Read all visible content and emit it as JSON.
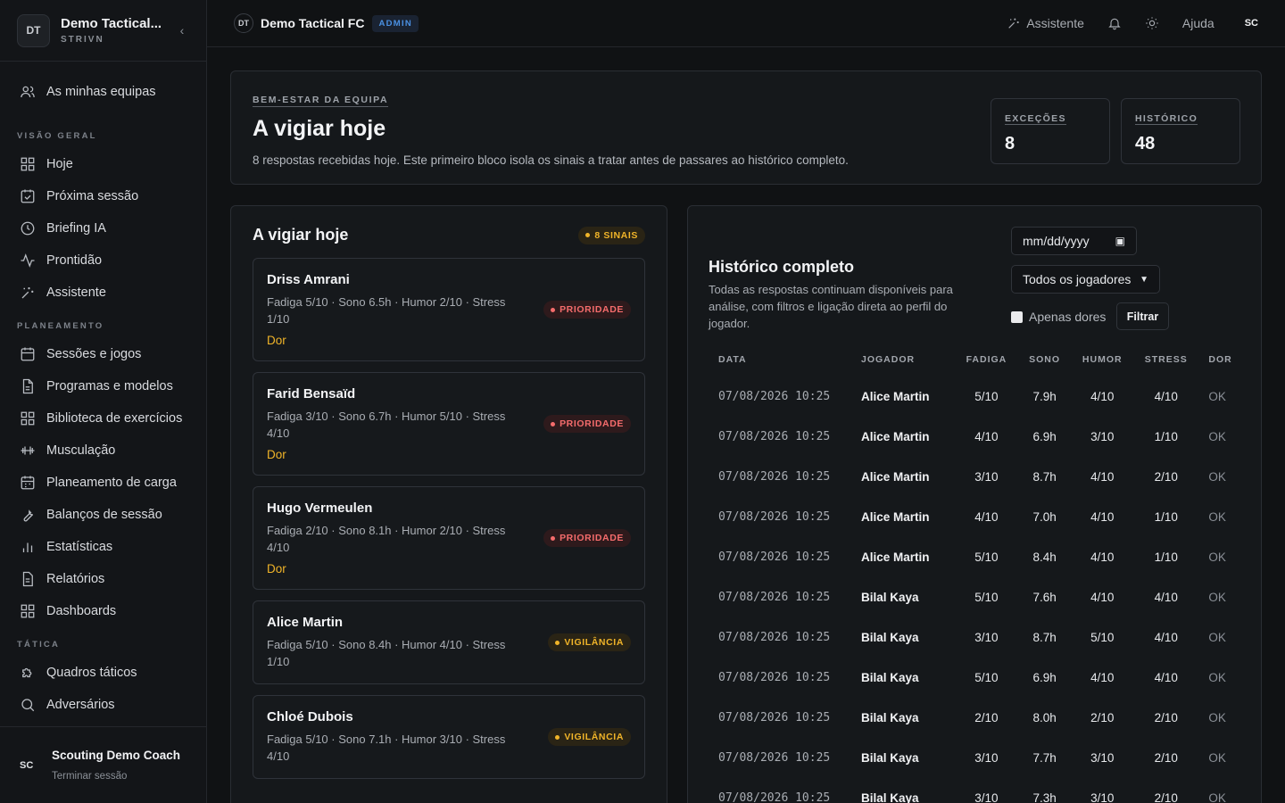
{
  "sidebar": {
    "team_initials": "DT",
    "team_name": "Demo Tactical...",
    "org": "STRIVN",
    "top_item": "As minhas equipas",
    "sections": [
      {
        "title": "VISÃO GERAL",
        "items": [
          "Hoje",
          "Próxima sessão",
          "Briefing IA",
          "Prontidão",
          "Assistente"
        ]
      },
      {
        "title": "PLANEAMENTO",
        "items": [
          "Sessões e jogos",
          "Programas e modelos",
          "Biblioteca de exercícios",
          "Musculação",
          "Planeamento de carga",
          "Balanços de sessão",
          "Estatísticas",
          "Relatórios",
          "Dashboards"
        ]
      },
      {
        "title": "TÁTICA",
        "items": [
          "Quadros táticos",
          "Adversários"
        ]
      }
    ],
    "user_initials": "SC",
    "user_name": "Scouting Demo Coach",
    "logout": "Terminar sessão"
  },
  "topbar": {
    "initials": "DT",
    "team": "Demo Tactical FC",
    "badge": "ADMIN",
    "assistant": "Assistente",
    "help": "Ajuda",
    "user": "SC"
  },
  "hero": {
    "eyebrow": "BEM-ESTAR DA EQUIPA",
    "title": "A vigiar hoje",
    "subtitle": "8 respostas recebidas hoje. Este primeiro bloco isola os sinais a tratar antes de passares ao histórico completo.",
    "stats": [
      {
        "label": "EXCEÇÕES",
        "value": "8"
      },
      {
        "label": "HISTÓRICO",
        "value": "48"
      }
    ]
  },
  "watch": {
    "title": "A vigiar hoje",
    "count_badge": "8 SINAIS",
    "items": [
      {
        "name": "Driss Amrani",
        "metrics": "Fadiga 5/10 · Sono 6.5h · Humor 2/10 · Stress 1/10",
        "flag": "Dor",
        "badge": "PRIORIDADE",
        "level": "prio"
      },
      {
        "name": "Farid Bensaïd",
        "metrics": "Fadiga 3/10 · Sono 6.7h · Humor 5/10 · Stress 4/10",
        "flag": "Dor",
        "badge": "PRIORIDADE",
        "level": "prio"
      },
      {
        "name": "Hugo Vermeulen",
        "metrics": "Fadiga 2/10 · Sono 8.1h · Humor 2/10 · Stress 4/10",
        "flag": "Dor",
        "badge": "PRIORIDADE",
        "level": "prio"
      },
      {
        "name": "Alice Martin",
        "metrics": "Fadiga 5/10 · Sono 8.4h · Humor 4/10 · Stress 1/10",
        "flag": "",
        "badge": "VIGILÂNCIA",
        "level": "warn"
      },
      {
        "name": "Chloé Dubois",
        "metrics": "Fadiga 5/10 · Sono 7.1h · Humor 3/10 · Stress 4/10",
        "flag": "",
        "badge": "VIGILÂNCIA",
        "level": "warn"
      }
    ]
  },
  "history": {
    "title": "Histórico completo",
    "description": "Todas as respostas continuam disponíveis para análise, com filtros e ligação direta ao perfil do jogador.",
    "date_placeholder": "mm/dd/yyyy",
    "player_select": "Todos os jogadores",
    "pain_only": "Apenas dores",
    "filter": "Filtrar",
    "columns": [
      "DATA",
      "JOGADOR",
      "FADIGA",
      "SONO",
      "HUMOR",
      "STRESS",
      "DOR"
    ],
    "rows": [
      [
        "07/08/2026 10:25",
        "Alice Martin",
        "5/10",
        "7.9h",
        "4/10",
        "4/10",
        "OK"
      ],
      [
        "07/08/2026 10:25",
        "Alice Martin",
        "4/10",
        "6.9h",
        "3/10",
        "1/10",
        "OK"
      ],
      [
        "07/08/2026 10:25",
        "Alice Martin",
        "3/10",
        "8.7h",
        "4/10",
        "2/10",
        "OK"
      ],
      [
        "07/08/2026 10:25",
        "Alice Martin",
        "4/10",
        "7.0h",
        "4/10",
        "1/10",
        "OK"
      ],
      [
        "07/08/2026 10:25",
        "Alice Martin",
        "5/10",
        "8.4h",
        "4/10",
        "1/10",
        "OK"
      ],
      [
        "07/08/2026 10:25",
        "Bilal Kaya",
        "5/10",
        "7.6h",
        "4/10",
        "4/10",
        "OK"
      ],
      [
        "07/08/2026 10:25",
        "Bilal Kaya",
        "3/10",
        "8.7h",
        "5/10",
        "4/10",
        "OK"
      ],
      [
        "07/08/2026 10:25",
        "Bilal Kaya",
        "5/10",
        "6.9h",
        "4/10",
        "4/10",
        "OK"
      ],
      [
        "07/08/2026 10:25",
        "Bilal Kaya",
        "2/10",
        "8.0h",
        "2/10",
        "2/10",
        "OK"
      ],
      [
        "07/08/2026 10:25",
        "Bilal Kaya",
        "3/10",
        "7.7h",
        "3/10",
        "2/10",
        "OK"
      ],
      [
        "07/08/2026 10:25",
        "Bilal Kaya",
        "3/10",
        "7.3h",
        "3/10",
        "2/10",
        "OK"
      ]
    ]
  }
}
